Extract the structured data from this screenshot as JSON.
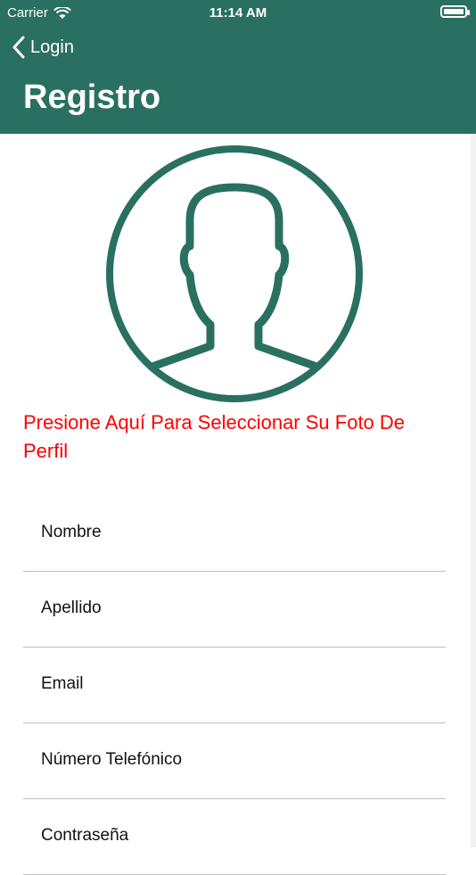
{
  "status_bar": {
    "carrier": "Carrier",
    "time": "11:14 AM"
  },
  "nav": {
    "back_label": "Login",
    "title": "Registro"
  },
  "profile": {
    "prompt": "Presione Aquí Para Seleccionar Su Foto De Perfil",
    "prompt_color": "#ff0000"
  },
  "form": {
    "fields": [
      {
        "placeholder": "Nombre"
      },
      {
        "placeholder": "Apellido"
      },
      {
        "placeholder": "Email"
      },
      {
        "placeholder": "Número Telefónico"
      },
      {
        "placeholder": "Contraseña"
      }
    ]
  },
  "colors": {
    "header_bg": "#2a7060",
    "avatar_stroke": "#2a7060"
  }
}
